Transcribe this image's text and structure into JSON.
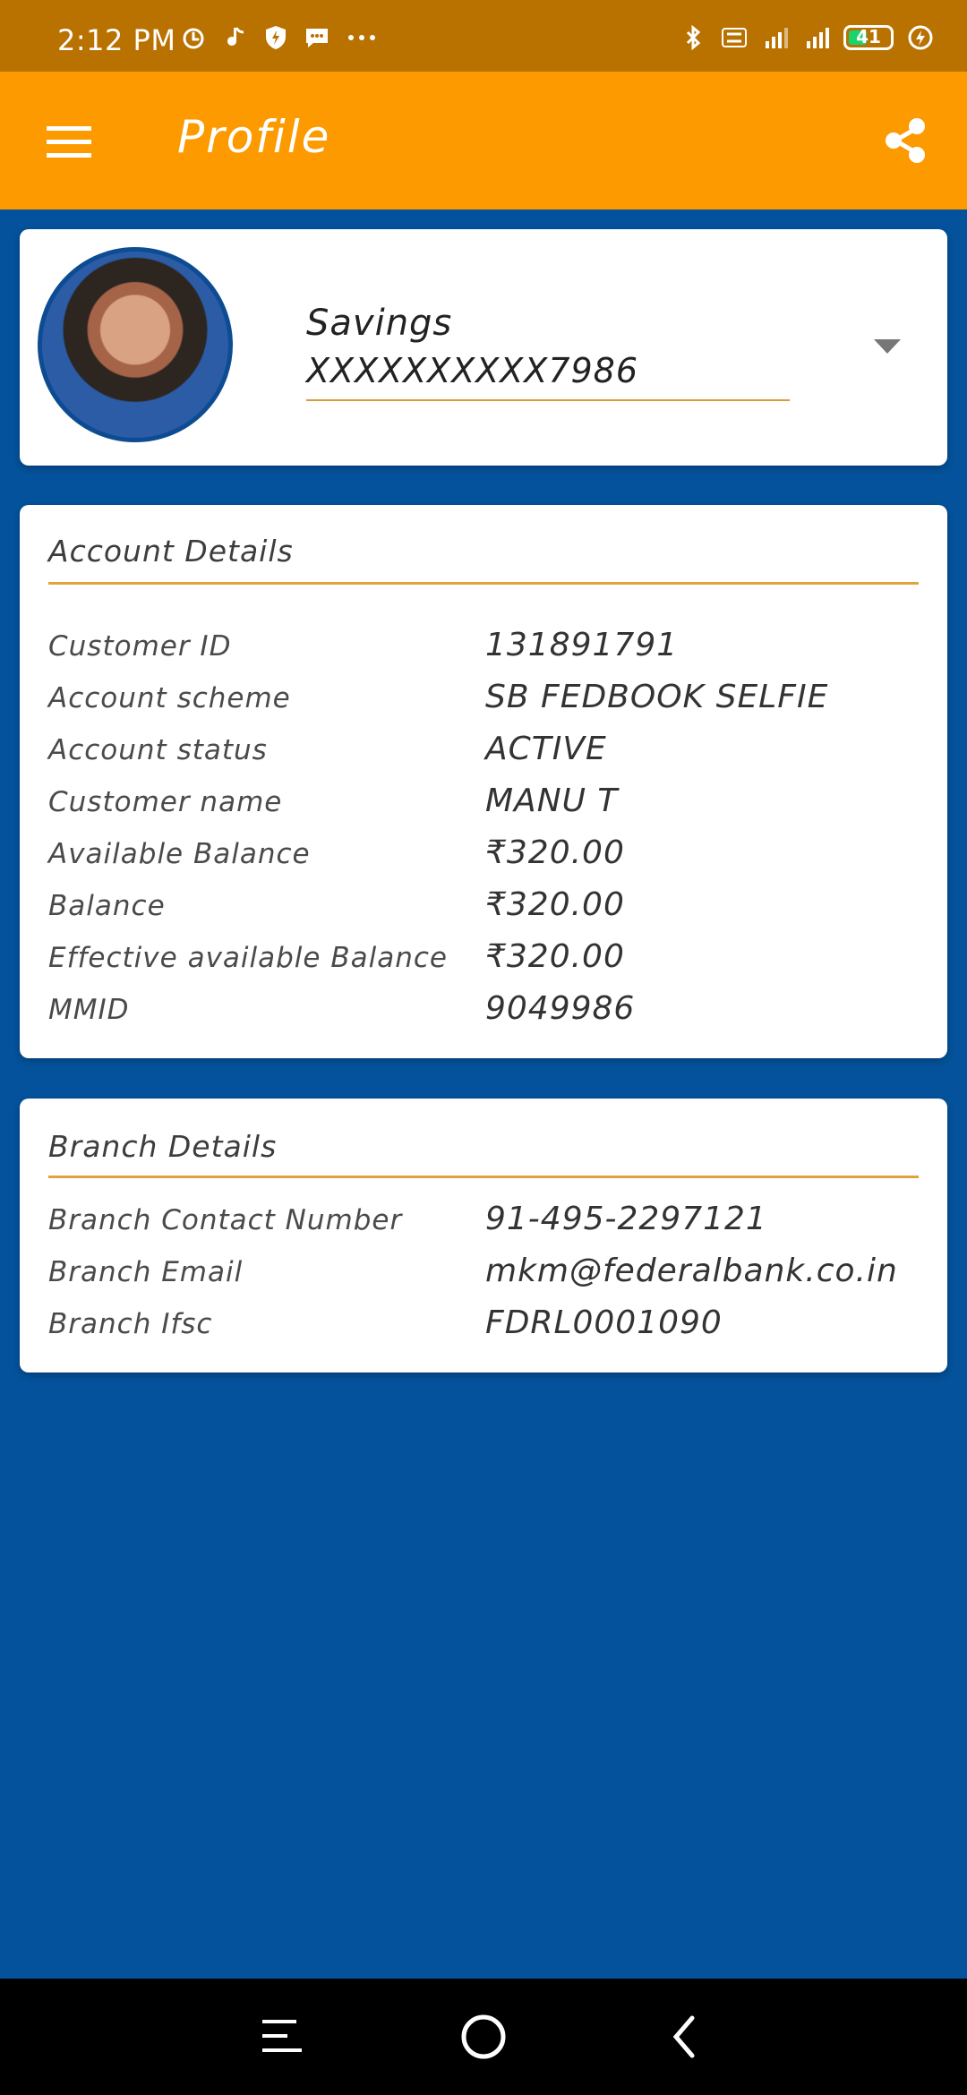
{
  "status_bar": {
    "time": "2:12 PM",
    "battery": "41",
    "left_icons": [
      "alarm-icon",
      "music-icon",
      "shield-icon",
      "message-icon",
      "more-dots-icon"
    ],
    "right_icons": [
      "bluetooth-icon",
      "volte-icon",
      "signal-icon",
      "signal-icon",
      "battery-icon",
      "charging-icon"
    ]
  },
  "app_bar": {
    "title": "Profile",
    "menu_icon": "hamburger-menu-icon",
    "share_icon": "share-icon"
  },
  "profile": {
    "account_type": "Savings",
    "account_number": "XXXXXXXXXX7986",
    "dropdown_icon": "dropdown-arrow-icon"
  },
  "account_details": {
    "title": "Account Details",
    "rows": [
      {
        "label": "Customer ID",
        "value": "131891791"
      },
      {
        "label": "Account scheme",
        "value": "SB FEDBOOK SELFIE"
      },
      {
        "label": "Account status",
        "value": "ACTIVE"
      },
      {
        "label": "Customer name",
        "value": "MANU T"
      },
      {
        "label": "Available Balance",
        "value": "₹320.00"
      },
      {
        "label": "Balance",
        "value": "₹320.00"
      },
      {
        "label": "Effective available Balance",
        "value": "₹320.00"
      },
      {
        "label": "MMID",
        "value": "9049986"
      }
    ]
  },
  "branch_details": {
    "title": "Branch Details",
    "rows": [
      {
        "label": "Branch Contact Number",
        "value": "91-495-2297121"
      },
      {
        "label": "Branch Email",
        "value": "mkm@federalbank.co.in"
      },
      {
        "label": "Branch Ifsc",
        "value": "FDRL0001090"
      }
    ]
  },
  "colors": {
    "status_bar": "#b97100",
    "app_bar": "#fc9a00",
    "background": "#04529b",
    "divider": "#e1a23a"
  }
}
